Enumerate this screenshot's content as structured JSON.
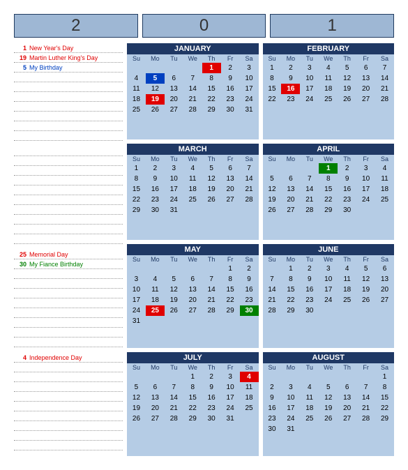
{
  "header": [
    "2",
    "0",
    "1"
  ],
  "dow": [
    "Su",
    "Mo",
    "Tu",
    "We",
    "Th",
    "Fr",
    "Sa"
  ],
  "events": [
    [
      {
        "day": "1",
        "label": "New Year's Day",
        "cls": "event-red"
      },
      {
        "day": "19",
        "label": "Martin Luther King's Day",
        "cls": "event-red"
      },
      {
        "day": "5",
        "label": "My Birthday",
        "cls": "event-blue"
      }
    ],
    [],
    [
      {
        "day": "25",
        "label": "Memorial Day",
        "cls": "event-red"
      },
      {
        "day": "30",
        "label": "My Fiance Birthday",
        "cls": "event-green"
      }
    ],
    [
      {
        "day": "4",
        "label": "Independence Day",
        "cls": "event-red"
      }
    ]
  ],
  "months": [
    {
      "name": "JANUARY",
      "weeks": [
        [
          {
            "d": "",
            "p": 1
          },
          {
            "d": "",
            "p": 1
          },
          {
            "d": "",
            "p": 1
          },
          {
            "d": "",
            "p": 1
          },
          {
            "d": "1",
            "hl": "red"
          },
          {
            "d": "2"
          },
          {
            "d": "3"
          }
        ],
        [
          {
            "d": "4"
          },
          {
            "d": "5",
            "hl": "blue"
          },
          {
            "d": "6"
          },
          {
            "d": "7"
          },
          {
            "d": "8"
          },
          {
            "d": "9"
          },
          {
            "d": "10"
          }
        ],
        [
          {
            "d": "11"
          },
          {
            "d": "12"
          },
          {
            "d": "13"
          },
          {
            "d": "14"
          },
          {
            "d": "15"
          },
          {
            "d": "16"
          },
          {
            "d": "17"
          }
        ],
        [
          {
            "d": "18"
          },
          {
            "d": "19",
            "hl": "red"
          },
          {
            "d": "20"
          },
          {
            "d": "21"
          },
          {
            "d": "22"
          },
          {
            "d": "23"
          },
          {
            "d": "24"
          }
        ],
        [
          {
            "d": "25"
          },
          {
            "d": "26"
          },
          {
            "d": "27"
          },
          {
            "d": "28"
          },
          {
            "d": "29"
          },
          {
            "d": "30"
          },
          {
            "d": "31"
          }
        ],
        [
          {
            "d": ""
          },
          {
            "d": ""
          },
          {
            "d": ""
          },
          {
            "d": ""
          },
          {
            "d": ""
          },
          {
            "d": ""
          },
          {
            "d": ""
          }
        ]
      ]
    },
    {
      "name": "FEBRUARY",
      "weeks": [
        [
          {
            "d": "1"
          },
          {
            "d": "2"
          },
          {
            "d": "3"
          },
          {
            "d": "4"
          },
          {
            "d": "5"
          },
          {
            "d": "6"
          },
          {
            "d": "7"
          }
        ],
        [
          {
            "d": "8"
          },
          {
            "d": "9"
          },
          {
            "d": "10"
          },
          {
            "d": "11"
          },
          {
            "d": "12"
          },
          {
            "d": "13"
          },
          {
            "d": "14"
          }
        ],
        [
          {
            "d": "15"
          },
          {
            "d": "16",
            "hl": "red"
          },
          {
            "d": "17"
          },
          {
            "d": "18"
          },
          {
            "d": "19"
          },
          {
            "d": "20"
          },
          {
            "d": "21"
          }
        ],
        [
          {
            "d": "22"
          },
          {
            "d": "23"
          },
          {
            "d": "24"
          },
          {
            "d": "25"
          },
          {
            "d": "26"
          },
          {
            "d": "27"
          },
          {
            "d": "28"
          }
        ],
        [
          {
            "d": ""
          },
          {
            "d": ""
          },
          {
            "d": ""
          },
          {
            "d": ""
          },
          {
            "d": ""
          },
          {
            "d": ""
          },
          {
            "d": ""
          }
        ],
        [
          {
            "d": ""
          },
          {
            "d": ""
          },
          {
            "d": ""
          },
          {
            "d": ""
          },
          {
            "d": ""
          },
          {
            "d": ""
          },
          {
            "d": ""
          }
        ]
      ]
    },
    {
      "name": "MARCH",
      "weeks": [
        [
          {
            "d": "1"
          },
          {
            "d": "2"
          },
          {
            "d": "3"
          },
          {
            "d": "4"
          },
          {
            "d": "5"
          },
          {
            "d": "6"
          },
          {
            "d": "7"
          }
        ],
        [
          {
            "d": "8"
          },
          {
            "d": "9"
          },
          {
            "d": "10"
          },
          {
            "d": "11"
          },
          {
            "d": "12"
          },
          {
            "d": "13"
          },
          {
            "d": "14"
          }
        ],
        [
          {
            "d": "15"
          },
          {
            "d": "16"
          },
          {
            "d": "17"
          },
          {
            "d": "18"
          },
          {
            "d": "19"
          },
          {
            "d": "20"
          },
          {
            "d": "21"
          }
        ],
        [
          {
            "d": "22"
          },
          {
            "d": "23"
          },
          {
            "d": "24"
          },
          {
            "d": "25"
          },
          {
            "d": "26"
          },
          {
            "d": "27"
          },
          {
            "d": "28"
          }
        ],
        [
          {
            "d": "29"
          },
          {
            "d": "30"
          },
          {
            "d": "31"
          },
          {
            "d": ""
          },
          {
            "d": ""
          },
          {
            "d": ""
          },
          {
            "d": ""
          }
        ],
        [
          {
            "d": ""
          },
          {
            "d": ""
          },
          {
            "d": ""
          },
          {
            "d": ""
          },
          {
            "d": ""
          },
          {
            "d": ""
          },
          {
            "d": ""
          }
        ]
      ]
    },
    {
      "name": "APRIL",
      "weeks": [
        [
          {
            "d": "",
            "p": 1
          },
          {
            "d": "",
            "p": 1
          },
          {
            "d": "",
            "p": 1
          },
          {
            "d": "1",
            "hl": "green"
          },
          {
            "d": "2"
          },
          {
            "d": "3"
          },
          {
            "d": "4"
          }
        ],
        [
          {
            "d": "5"
          },
          {
            "d": "6"
          },
          {
            "d": "7"
          },
          {
            "d": "8"
          },
          {
            "d": "9"
          },
          {
            "d": "10"
          },
          {
            "d": "11"
          }
        ],
        [
          {
            "d": "12"
          },
          {
            "d": "13"
          },
          {
            "d": "14"
          },
          {
            "d": "15"
          },
          {
            "d": "16"
          },
          {
            "d": "17"
          },
          {
            "d": "18"
          }
        ],
        [
          {
            "d": "19"
          },
          {
            "d": "20"
          },
          {
            "d": "21"
          },
          {
            "d": "22"
          },
          {
            "d": "23"
          },
          {
            "d": "24"
          },
          {
            "d": "25"
          }
        ],
        [
          {
            "d": "26"
          },
          {
            "d": "27"
          },
          {
            "d": "28"
          },
          {
            "d": "29"
          },
          {
            "d": "30"
          },
          {
            "d": ""
          },
          {
            "d": ""
          }
        ],
        [
          {
            "d": ""
          },
          {
            "d": ""
          },
          {
            "d": ""
          },
          {
            "d": ""
          },
          {
            "d": ""
          },
          {
            "d": ""
          },
          {
            "d": ""
          }
        ]
      ]
    },
    {
      "name": "MAY",
      "weeks": [
        [
          {
            "d": "",
            "p": 1
          },
          {
            "d": "",
            "p": 1
          },
          {
            "d": "",
            "p": 1
          },
          {
            "d": "",
            "p": 1
          },
          {
            "d": "",
            "p": 1
          },
          {
            "d": "1"
          },
          {
            "d": "2"
          }
        ],
        [
          {
            "d": "3"
          },
          {
            "d": "4"
          },
          {
            "d": "5"
          },
          {
            "d": "6"
          },
          {
            "d": "7"
          },
          {
            "d": "8"
          },
          {
            "d": "9"
          }
        ],
        [
          {
            "d": "10"
          },
          {
            "d": "11"
          },
          {
            "d": "12"
          },
          {
            "d": "13"
          },
          {
            "d": "14"
          },
          {
            "d": "15"
          },
          {
            "d": "16"
          }
        ],
        [
          {
            "d": "17"
          },
          {
            "d": "18"
          },
          {
            "d": "19"
          },
          {
            "d": "20"
          },
          {
            "d": "21"
          },
          {
            "d": "22"
          },
          {
            "d": "23"
          }
        ],
        [
          {
            "d": "24"
          },
          {
            "d": "25",
            "hl": "red"
          },
          {
            "d": "26"
          },
          {
            "d": "27"
          },
          {
            "d": "28"
          },
          {
            "d": "29"
          },
          {
            "d": "30",
            "hl": "green"
          }
        ],
        [
          {
            "d": "31"
          },
          {
            "d": ""
          },
          {
            "d": ""
          },
          {
            "d": ""
          },
          {
            "d": ""
          },
          {
            "d": ""
          },
          {
            "d": ""
          }
        ]
      ]
    },
    {
      "name": "JUNE",
      "weeks": [
        [
          {
            "d": "",
            "p": 1
          },
          {
            "d": "1"
          },
          {
            "d": "2"
          },
          {
            "d": "3"
          },
          {
            "d": "4"
          },
          {
            "d": "5"
          },
          {
            "d": "6"
          }
        ],
        [
          {
            "d": "7"
          },
          {
            "d": "8"
          },
          {
            "d": "9"
          },
          {
            "d": "10"
          },
          {
            "d": "11"
          },
          {
            "d": "12"
          },
          {
            "d": "13"
          }
        ],
        [
          {
            "d": "14"
          },
          {
            "d": "15"
          },
          {
            "d": "16"
          },
          {
            "d": "17"
          },
          {
            "d": "18"
          },
          {
            "d": "19"
          },
          {
            "d": "20"
          }
        ],
        [
          {
            "d": "21"
          },
          {
            "d": "22"
          },
          {
            "d": "23"
          },
          {
            "d": "24"
          },
          {
            "d": "25"
          },
          {
            "d": "26"
          },
          {
            "d": "27"
          }
        ],
        [
          {
            "d": "28"
          },
          {
            "d": "29"
          },
          {
            "d": "30"
          },
          {
            "d": ""
          },
          {
            "d": ""
          },
          {
            "d": ""
          },
          {
            "d": ""
          }
        ],
        [
          {
            "d": ""
          },
          {
            "d": ""
          },
          {
            "d": ""
          },
          {
            "d": ""
          },
          {
            "d": ""
          },
          {
            "d": ""
          },
          {
            "d": ""
          }
        ]
      ]
    },
    {
      "name": "JULY",
      "weeks": [
        [
          {
            "d": "",
            "p": 1
          },
          {
            "d": "",
            "p": 1
          },
          {
            "d": "",
            "p": 1
          },
          {
            "d": "1"
          },
          {
            "d": "2"
          },
          {
            "d": "3"
          },
          {
            "d": "4",
            "hl": "red"
          }
        ],
        [
          {
            "d": "5"
          },
          {
            "d": "6"
          },
          {
            "d": "7"
          },
          {
            "d": "8"
          },
          {
            "d": "9"
          },
          {
            "d": "10"
          },
          {
            "d": "11"
          }
        ],
        [
          {
            "d": "12"
          },
          {
            "d": "13"
          },
          {
            "d": "14"
          },
          {
            "d": "15"
          },
          {
            "d": "16"
          },
          {
            "d": "17"
          },
          {
            "d": "18"
          }
        ],
        [
          {
            "d": "19"
          },
          {
            "d": "20"
          },
          {
            "d": "21"
          },
          {
            "d": "22"
          },
          {
            "d": "23"
          },
          {
            "d": "24"
          },
          {
            "d": "25"
          }
        ],
        [
          {
            "d": "26"
          },
          {
            "d": "27"
          },
          {
            "d": "28"
          },
          {
            "d": "29"
          },
          {
            "d": "30"
          },
          {
            "d": "31"
          },
          {
            "d": ""
          }
        ],
        [
          {
            "d": ""
          },
          {
            "d": ""
          },
          {
            "d": ""
          },
          {
            "d": ""
          },
          {
            "d": ""
          },
          {
            "d": ""
          },
          {
            "d": ""
          }
        ]
      ]
    },
    {
      "name": "AUGUST",
      "weeks": [
        [
          {
            "d": "",
            "p": 1
          },
          {
            "d": "",
            "p": 1
          },
          {
            "d": "",
            "p": 1
          },
          {
            "d": "",
            "p": 1
          },
          {
            "d": "",
            "p": 1
          },
          {
            "d": "",
            "p": 1
          },
          {
            "d": "1"
          }
        ],
        [
          {
            "d": "2"
          },
          {
            "d": "3"
          },
          {
            "d": "4"
          },
          {
            "d": "5"
          },
          {
            "d": "6"
          },
          {
            "d": "7"
          },
          {
            "d": "8"
          }
        ],
        [
          {
            "d": "9"
          },
          {
            "d": "10"
          },
          {
            "d": "11"
          },
          {
            "d": "12"
          },
          {
            "d": "13"
          },
          {
            "d": "14"
          },
          {
            "d": "15"
          }
        ],
        [
          {
            "d": "16"
          },
          {
            "d": "17"
          },
          {
            "d": "18"
          },
          {
            "d": "19"
          },
          {
            "d": "20"
          },
          {
            "d": "21"
          },
          {
            "d": "22"
          }
        ],
        [
          {
            "d": "23"
          },
          {
            "d": "24"
          },
          {
            "d": "25"
          },
          {
            "d": "26"
          },
          {
            "d": "27"
          },
          {
            "d": "28"
          },
          {
            "d": "29"
          }
        ],
        [
          {
            "d": "30"
          },
          {
            "d": "31"
          },
          {
            "d": ""
          },
          {
            "d": ""
          },
          {
            "d": ""
          },
          {
            "d": ""
          },
          {
            "d": ""
          }
        ]
      ]
    }
  ]
}
